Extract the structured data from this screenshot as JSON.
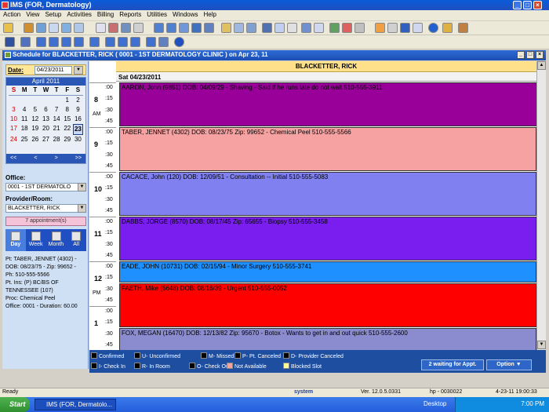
{
  "window": {
    "title": "IMS (FOR, Dermatology)"
  },
  "menu": [
    "Action",
    "View",
    "Setup",
    "Activities",
    "Billing",
    "Reports",
    "Utilities",
    "Windows",
    "Help"
  ],
  "schedule_window": {
    "title": "Schedule for BLACKETTER, RICK  ( 0001 - 1ST DERMATOLOGY CLINIC )  on  Apr 23, 11"
  },
  "left_panel": {
    "date_label": "Date:",
    "date_value": "04/23/2011",
    "calendar": {
      "month": "April 2011",
      "day_headers": [
        "S",
        "M",
        "T",
        "W",
        "T",
        "F",
        "S"
      ],
      "weeks": [
        [
          "",
          "",
          "",
          "",
          "",
          "1",
          "2"
        ],
        [
          "3",
          "4",
          "5",
          "6",
          "7",
          "8",
          "9"
        ],
        [
          "10",
          "11",
          "12",
          "13",
          "14",
          "15",
          "16"
        ],
        [
          "17",
          "18",
          "19",
          "20",
          "21",
          "22",
          "23"
        ],
        [
          "24",
          "25",
          "26",
          "27",
          "28",
          "29",
          "30"
        ]
      ],
      "selected_day": "23",
      "nav": [
        "<<",
        "<",
        ">",
        ">>"
      ]
    },
    "office_label": "Office:",
    "office_value": "0001 - 1ST DERMATOLO",
    "provider_label": "Provider/Room:",
    "provider_value": "BLACKETTER, RICK",
    "appointments_button": "7 appointment(s)",
    "views": [
      "Day",
      "Week",
      "Month",
      "All"
    ],
    "patient_info": [
      "Pt: TABER, JENNET  (4302) -",
      "DOB: 08/23/75 - Zip: 99652 -",
      "Ph: 510-555-5566",
      "Pt. Ins: (P) BC/BS OF",
      "TENNESSEE (107)",
      "Proc: Chemical Peel",
      "Office: 0001  - Duration: 60.00"
    ]
  },
  "schedule": {
    "provider_header": "BLACKETTER, RICK",
    "date_header": "Sat 04/23/2011",
    "hours": [
      {
        "hour": "8",
        "ampm": "AM"
      },
      {
        "hour": "9",
        "ampm": ""
      },
      {
        "hour": "10",
        "ampm": ""
      },
      {
        "hour": "11",
        "ampm": ""
      },
      {
        "hour": "12",
        "ampm": "PM"
      },
      {
        "hour": "1",
        "ampm": ""
      }
    ],
    "quarters": [
      ":00",
      ":15",
      ":30",
      ":45"
    ],
    "appointments": [
      {
        "text": "AARON, John  (9851)  DOB: 04/09/29 -  Shaving  - Said if he runs late do not wait      510-555-3911",
        "color": "#990099"
      },
      {
        "text": "TABER, JENNET  (4302)  DOB: 08/23/75  Zip: 99652 -  Chemical Peel      510-555-5566",
        "color": "#f7a2a2"
      },
      {
        "text": "CACACE, John  (120)  DOB: 12/09/51 -  Consultation -- Initial      510-555-5083",
        "color": "#8080f0"
      },
      {
        "text": "DABBS, JORGE  (8570)  DOB: 08/17/45  Zip: 65655 -  Biopsy      510-555-3458",
        "color": "#7a1ef0"
      },
      {
        "text": "EADE, JOHN  (10731)  DOB: 02/15/94 -  Minor Surgery      510-555-3741",
        "color": "#1e90ff"
      },
      {
        "text": "FAETH, Mike  (6648)  DOB: 08/16/39 -  Urgent      510-555-0052",
        "color": "#ff0000"
      },
      {
        "text": "FOX, MEGAN  (16470)  DOB: 12/13/82  Zip: 95670 -  Botox - Wants to get in and out quick      510-555-2600",
        "color": "#8b8bcf"
      }
    ]
  },
  "legend": [
    {
      "label": "Confirmed",
      "color": "#000000"
    },
    {
      "label": "U- Unconfirmed",
      "color": "#000000"
    },
    {
      "label": "M- Missed",
      "color": "#000000"
    },
    {
      "label": "P- Pt. Canceled",
      "color": "#000000"
    },
    {
      "label": "D- Provider Canceled",
      "color": "#000000"
    },
    {
      "label": "I- Check In",
      "color": "#000000"
    },
    {
      "label": "R- In Room",
      "color": "#000000"
    },
    {
      "label": "O- Check Out",
      "color": "#000000"
    },
    {
      "label": "Not Available",
      "color": "#f7a2a2"
    },
    {
      "label": "Blocked Slot",
      "color": "#ffff99"
    }
  ],
  "waiting_button": "2 waiting for Appt.",
  "option_button": "Option",
  "status_bar": {
    "ready": "Ready",
    "user": "system",
    "version": "Ver. 12.0.5.0331",
    "station": "hp - 0030022",
    "datetime": "4-23-11 19:00:33"
  },
  "taskbar": {
    "start": "Start",
    "task": "IMS (FOR, Dermatolo...",
    "desktop": "Desktop",
    "clock": "7:00 PM"
  }
}
